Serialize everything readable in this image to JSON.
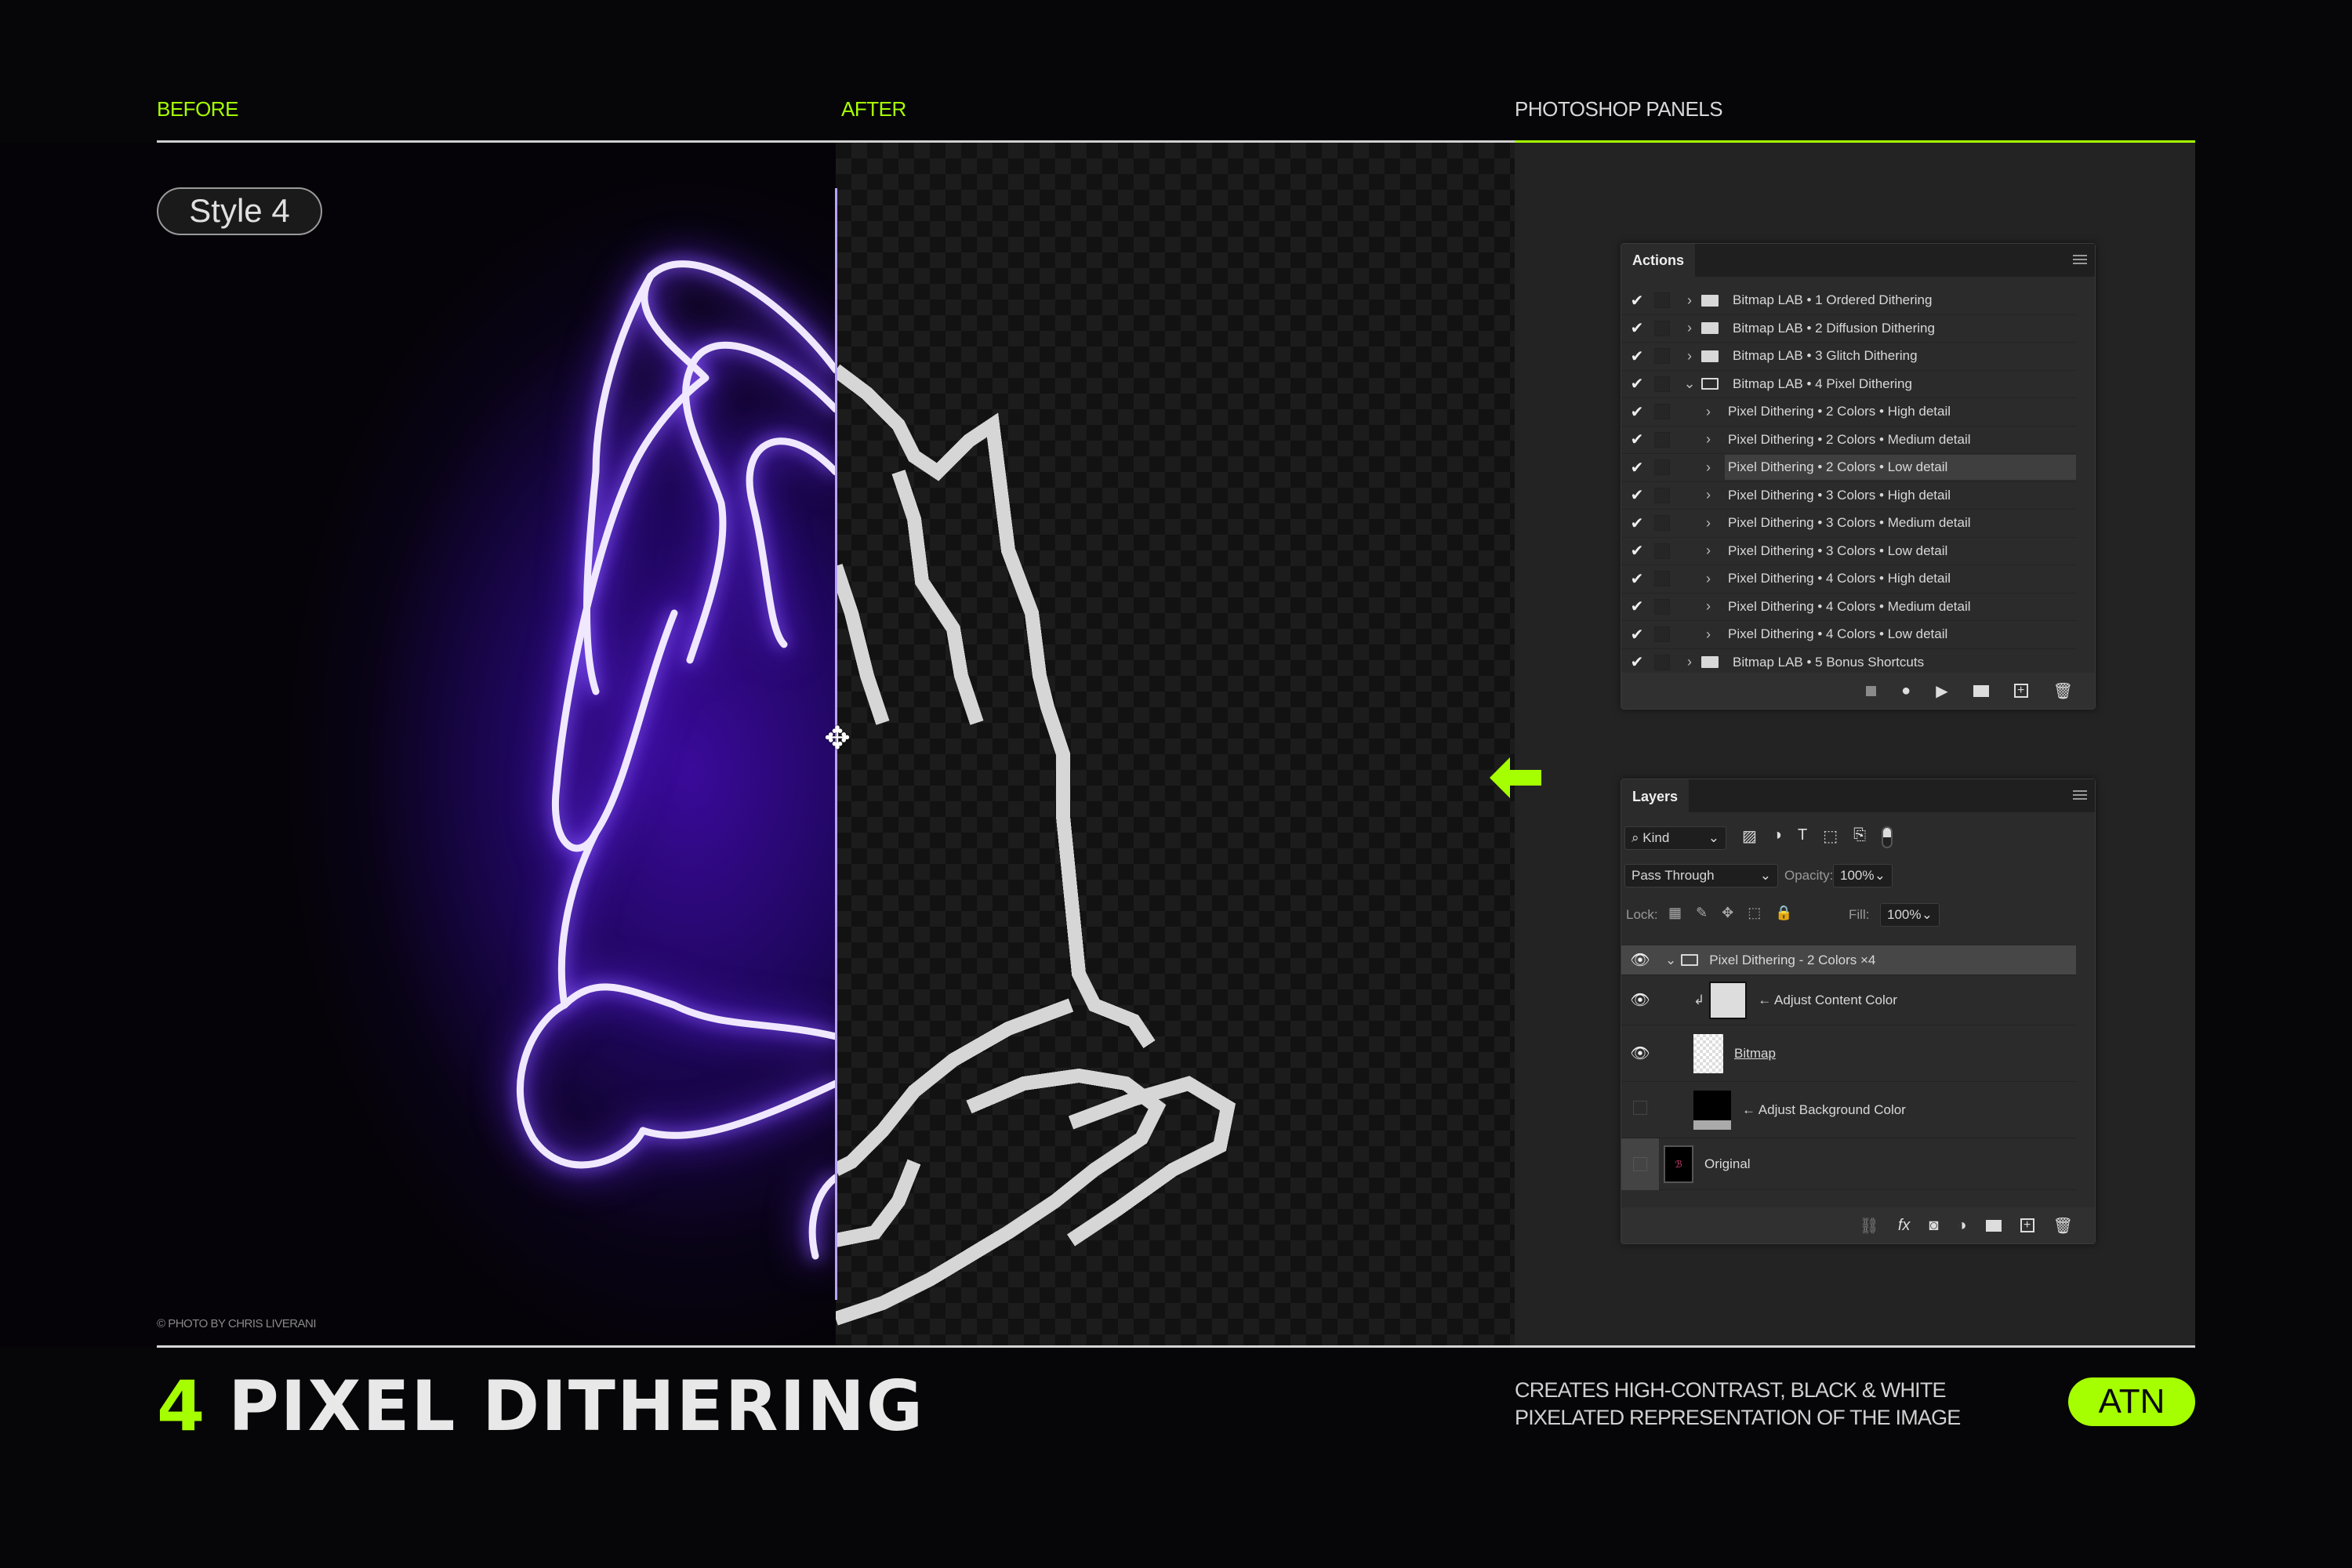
{
  "header": {
    "before": "BEFORE",
    "after": "AFTER",
    "panels": "PHOTOSHOP PANELS"
  },
  "style_label": "Style 4",
  "credit": "© PHOTO BY CHRIS LIVERANI",
  "title": {
    "number": "4",
    "text": "PIXEL DITHERING"
  },
  "description": [
    "CREATES HIGH-CONTRAST, BLACK & WHITE",
    "PIXELATED REPRESENTATION OF THE IMAGE"
  ],
  "badge": "ATN",
  "colors": {
    "accent": "#a6ff00",
    "divider": "#b9a2ff",
    "neon": "#5a1fd6"
  },
  "actions": {
    "title": "Actions",
    "items": [
      {
        "label": "Bitmap LAB • 1 Ordered Dithering",
        "type": "set",
        "expanded": false,
        "checked": true
      },
      {
        "label": "Bitmap LAB • 2 Diffusion Dithering",
        "type": "set",
        "expanded": false,
        "checked": true
      },
      {
        "label": "Bitmap LAB • 3 Glitch Dithering",
        "type": "set",
        "expanded": false,
        "checked": true
      },
      {
        "label": "Bitmap LAB • 4 Pixel Dithering",
        "type": "set",
        "expanded": true,
        "checked": true
      },
      {
        "label": "Pixel Dithering • 2 Colors • High detail",
        "type": "action",
        "checked": true
      },
      {
        "label": "Pixel Dithering • 2 Colors • Medium detail",
        "type": "action",
        "checked": true
      },
      {
        "label": "Pixel Dithering • 2 Colors • Low detail",
        "type": "action",
        "checked": true,
        "selected": true
      },
      {
        "label": "Pixel Dithering • 3 Colors • High detail",
        "type": "action",
        "checked": true
      },
      {
        "label": "Pixel Dithering • 3 Colors • Medium detail",
        "type": "action",
        "checked": true
      },
      {
        "label": "Pixel Dithering • 3 Colors • Low detail",
        "type": "action",
        "checked": true
      },
      {
        "label": "Pixel Dithering • 4 Colors • High detail",
        "type": "action",
        "checked": true
      },
      {
        "label": "Pixel Dithering • 4 Colors • Medium detail",
        "type": "action",
        "checked": true
      },
      {
        "label": "Pixel Dithering • 4 Colors • Low detail",
        "type": "action",
        "checked": true
      },
      {
        "label": "Bitmap LAB • 5 Bonus Shortcuts",
        "type": "set",
        "expanded": false,
        "checked": true
      }
    ],
    "footer_icons": [
      "stop-icon",
      "record-icon",
      "play-icon",
      "folder-icon",
      "new-action-icon",
      "trash-icon"
    ]
  },
  "layers": {
    "title": "Layers",
    "filter": "Kind",
    "blend_mode": "Pass Through",
    "opacity_label": "Opacity:",
    "opacity": "100%",
    "lock_label": "Lock:",
    "fill_label": "Fill:",
    "fill": "100%",
    "items": [
      {
        "name": "Pixel Dithering - 2 Colors ×4",
        "type": "group",
        "visible": true
      },
      {
        "name": "← Adjust Content Color",
        "type": "fill",
        "visible": true
      },
      {
        "name": "Bitmap",
        "type": "pixel",
        "visible": true
      },
      {
        "name": "← Adjust Background Color",
        "type": "fill",
        "visible": false
      },
      {
        "name": "Original",
        "type": "image",
        "visible": false
      }
    ],
    "footer_icons": [
      "link-icon",
      "fx-icon",
      "mask-icon",
      "adjustment-icon",
      "folder-icon",
      "new-layer-icon",
      "trash-icon"
    ]
  }
}
